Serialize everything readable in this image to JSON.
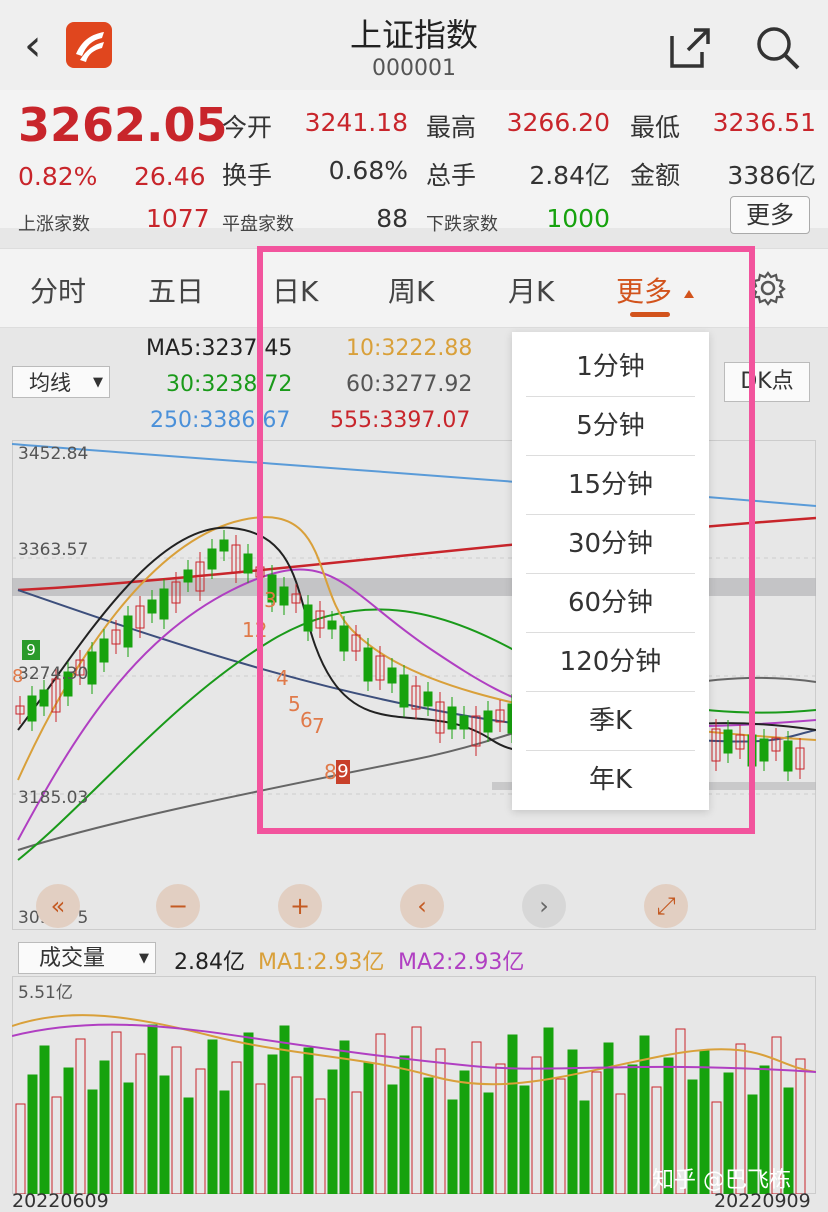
{
  "header": {
    "title": "上证指数",
    "code": "000001",
    "back": "‹"
  },
  "quote": {
    "price": "3262.05",
    "pct": "0.82%",
    "change": "26.46",
    "up_label": "上涨家数",
    "up_count": "1077",
    "flat_label": "平盘家数",
    "flat_count": "88",
    "down_label": "下跌家数",
    "down_count": "1000",
    "open_label": "今开",
    "open": "3241.18",
    "high_label": "最高",
    "high": "3266.20",
    "low_label": "最低",
    "low": "3236.51",
    "turnover_label": "换手",
    "turnover": "0.68%",
    "volume_label": "总手",
    "volume": "2.84亿",
    "amount_label": "金额",
    "amount": "3386亿",
    "more_button": "更多"
  },
  "tabs": [
    {
      "label": "分时"
    },
    {
      "label": "五日"
    },
    {
      "label": "日K"
    },
    {
      "label": "周K"
    },
    {
      "label": "月K"
    },
    {
      "label": "更多"
    }
  ],
  "ma": {
    "ma5": "MA5:3237.45",
    "ma10": "10:3222.88",
    "ma30": "30:3238.72",
    "ma60": "60:3277.92",
    "ma250": "250:3386.67",
    "ma555": "555:3397.07",
    "select": "均线",
    "dk_button": "DK点"
  },
  "axis": {
    "y1": "3452.84",
    "y2": "3363.57",
    "y3": "3274.30",
    "y4": "3185.03",
    "y5": "3095.75"
  },
  "signals": [
    "3",
    "12",
    "4",
    "5",
    "6",
    "7",
    "8",
    "9"
  ],
  "left_signals": [
    "9",
    "8"
  ],
  "volume": {
    "select": "成交量",
    "value": "2.84亿",
    "ma1": "MA1:2.93亿",
    "ma2": "MA2:2.93亿",
    "max": "5.51亿"
  },
  "dates": {
    "start": "20220609",
    "end": "20220909"
  },
  "dropdown": [
    "1分钟",
    "5分钟",
    "15分钟",
    "30分钟",
    "60分钟",
    "120分钟",
    "季K",
    "年K"
  ],
  "watermark": "知乎 @巴飞栋",
  "colors": {
    "up": "#c8252b",
    "down": "#17a20e",
    "accent": "#d2531c",
    "highlight": "#f2549d"
  }
}
